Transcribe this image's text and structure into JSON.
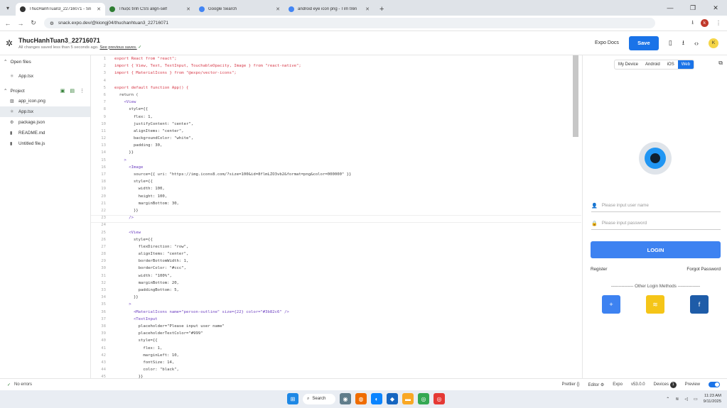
{
  "tabs": [
    {
      "title": "ThucHanhTuan3_22716071 - Sn",
      "color": "#333333",
      "active": true
    },
    {
      "title": "Thuộc tính CSS align-self",
      "color": "#2e7d32",
      "active": false
    },
    {
      "title": "Google Search",
      "color": "#4285f4",
      "active": false
    },
    {
      "title": "android eye icon png - Tìm trên",
      "color": "#4285f4",
      "active": false
    }
  ],
  "address": {
    "url": "snack.expo.dev/@kiongj04/thuchanhtuan3_22716071",
    "profile": "k"
  },
  "header": {
    "project_title": "ThucHanhTuan3_22716071",
    "saved_text": "All changes saved less than 5 seconds ago.",
    "previous_saves": "See previous saves.",
    "expo_docs": "Expo Docs",
    "save_label": "Save",
    "avatar": "K"
  },
  "sidebar": {
    "open_files_label": "Open files",
    "open_files": [
      "App.tsx"
    ],
    "project_label": "Project",
    "project_files": [
      {
        "name": "app_icon.png",
        "icon": "image-icon"
      },
      {
        "name": "App.tsx",
        "icon": "react-icon",
        "selected": true
      },
      {
        "name": "package.json",
        "icon": "gear-icon"
      },
      {
        "name": "README.md",
        "icon": "file-icon"
      },
      {
        "name": "Untitled file.js",
        "icon": "file-icon"
      }
    ]
  },
  "code_lines": [
    "export React from \"react\";",
    "import { View, Text, TextInput, TouchableOpacity, Image } from \"react-native\";",
    "import { MaterialIcons } from \"@expo/vector-icons\";",
    "",
    "export default function App() {",
    "  return (",
    "    <View",
    "      style={{",
    "        flex: 1,",
    "        justifyContent: \"center\",",
    "        alignItems: \"center\",",
    "        backgroundColor: \"white\",",
    "        padding: 30,",
    "      }}",
    "    >",
    "      <Image",
    "        source={{ uri: \"https://img.icons8.com/?size=100&id=8flmLZO3vb2&format=png&color=000000\" }}",
    "        style={{",
    "          width: 100,",
    "          height: 100,",
    "          marginBottom: 30,",
    "        }}",
    "      />",
    "",
    "      <View",
    "        style={{",
    "          flexDirection: \"row\",",
    "          alignItems: \"center\",",
    "          borderBottomWidth: 1,",
    "          borderColor: \"#ccc\",",
    "          width: \"100%\",",
    "          marginBottom: 20,",
    "          paddingBottom: 5,",
    "        }}",
    "      >",
    "        <MaterialIcons name=\"person-outline\" size={22} color=\"#3b82c6\" />",
    "        <TextInput",
    "          placeholder=\"Please input user name\"",
    "          placeholderTextColor=\"#999\"",
    "          style={{",
    "            flex: 1,",
    "            marginLeft: 10,",
    "            fontSize: 14,",
    "            color: \"black\",",
    "          }}"
  ],
  "preview": {
    "tabs": [
      "My Device",
      "Android",
      "iOS",
      "Web"
    ],
    "active_tab": "Web",
    "username_placeholder": "Please input user name",
    "password_placeholder": "Please input password",
    "login_label": "LOGIN",
    "register_label": "Register",
    "forgot_label": "Forgot Password",
    "other_methods": "--------------- Other Login Methods ---------------",
    "social_colors": [
      "#3d82f1",
      "#f5c518",
      "#1e5ca8"
    ]
  },
  "status": {
    "errors": "No errors",
    "prettier": "Prettier",
    "editor": "Editor",
    "expo": "Expo",
    "version": "v53.0.0",
    "devices": "Devices",
    "devices_count": "1",
    "preview": "Preview"
  },
  "taskbar": {
    "search": "Search",
    "time": "11:23 AM",
    "date": "9/11/2025"
  }
}
